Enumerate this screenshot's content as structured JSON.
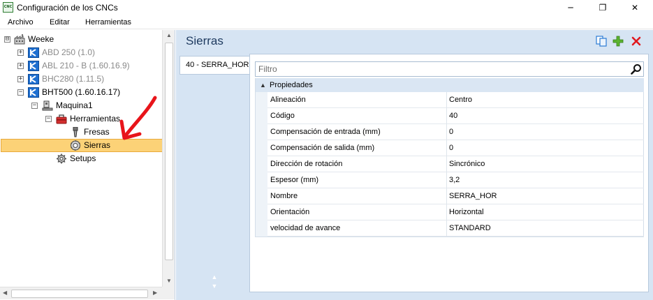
{
  "window": {
    "title": "Configuración de los CNCs",
    "app_icon_text": "CNC",
    "minimize_glyph": "─",
    "maximize_glyph": "❐",
    "close_glyph": "✕"
  },
  "menu": {
    "items": [
      "Archivo",
      "Editar",
      "Herramientas"
    ]
  },
  "tree": {
    "nodes": [
      {
        "label": "Weeke",
        "icon": "factory-icon",
        "expander": "⊟"
      },
      {
        "label": "ABD 250 (1.0)",
        "icon": "machine-icon",
        "expander": "+",
        "disabled": true
      },
      {
        "label": "ABL 210 - B (1.60.16.9)",
        "icon": "machine-icon",
        "expander": "+",
        "disabled": true
      },
      {
        "label": "BHC280 (1.11.5)",
        "icon": "machine-icon",
        "expander": "+",
        "disabled": true
      },
      {
        "label": "BHT500 (1.60.16.17)",
        "icon": "machine-icon",
        "expander": "−"
      },
      {
        "label": "Maquina1",
        "icon": "workstation-icon",
        "expander": "−"
      },
      {
        "label": "Herramientas",
        "icon": "toolbox-icon",
        "expander": "−"
      },
      {
        "label": "Fresas",
        "icon": "drill-bit-icon"
      },
      {
        "label": "Sierras",
        "icon": "saw-blade-icon",
        "selected": true
      },
      {
        "label": "Setups",
        "icon": "gear-icon"
      }
    ]
  },
  "main": {
    "title": "Sierras",
    "toolbar": {
      "copy_icon": "copy-icon",
      "add_icon": "add-icon",
      "delete_icon": "delete-icon"
    },
    "tabs": [
      {
        "label": "40 - SERRA_HOR",
        "active": true
      }
    ],
    "filter": {
      "placeholder": "Filtro",
      "value": ""
    },
    "properties": {
      "group_label": "Propiedades",
      "rows": [
        {
          "name": "Alineación",
          "value": "Centro"
        },
        {
          "name": "Código",
          "value": "40"
        },
        {
          "name": "Compensación de entrada (mm)",
          "value": "0"
        },
        {
          "name": "Compensación de salida (mm)",
          "value": "0"
        },
        {
          "name": "Dirección de rotación",
          "value": "Sincrónico"
        },
        {
          "name": "Espesor (mm)",
          "value": "3,2"
        },
        {
          "name": "Nombre",
          "value": "SERRA_HOR"
        },
        {
          "name": "Orientación",
          "value": "Horizontal"
        },
        {
          "name": "velocidad de avance",
          "value": "STANDARD"
        }
      ]
    }
  },
  "colors": {
    "selection": "#fcd277",
    "main_background": "#d6e4f3",
    "annotation_arrow": "#e8141a"
  }
}
